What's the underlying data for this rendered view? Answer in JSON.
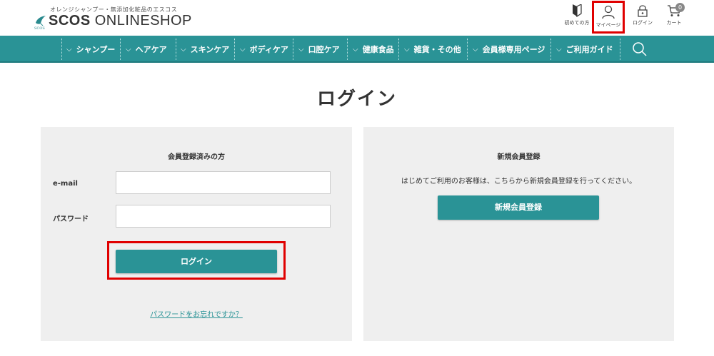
{
  "header": {
    "tagline": "オレンジシャンプー・無添加化粧品のエスコス",
    "logo_sub": "SCOS",
    "logo_bold": "SCOS ",
    "logo_light": "ONLINESHOP",
    "icons": {
      "first_time": "初めての方",
      "mypage": "マイページ",
      "login": "ログイン",
      "cart": "カート",
      "cart_count": "0"
    }
  },
  "nav": {
    "items": [
      {
        "label": "シャンプー"
      },
      {
        "label": "ヘアケア"
      },
      {
        "label": "スキンケア"
      },
      {
        "label": "ボディケア"
      },
      {
        "label": "口腔ケア"
      },
      {
        "label": "健康食品"
      },
      {
        "label": "雑貨・その他"
      },
      {
        "label": "会員様専用ページ"
      },
      {
        "label": "ご利用ガイド"
      }
    ]
  },
  "page": {
    "title": "ログイン"
  },
  "member": {
    "heading": "会員登録済みの方",
    "email_label": "e-mail",
    "email_value": "",
    "password_label": "パスワード",
    "password_value": "",
    "login_button": "ログイン",
    "forgot_link": "パスワードをお忘れですか？"
  },
  "new_member": {
    "heading": "新規会員登録",
    "description": "はじめてご利用のお客様は、こちらから新規会員登録を行ってください。",
    "register_button": "新規会員登録"
  },
  "colors": {
    "accent": "#2a9396",
    "highlight": "#e00000",
    "panel_bg": "#efefef"
  }
}
